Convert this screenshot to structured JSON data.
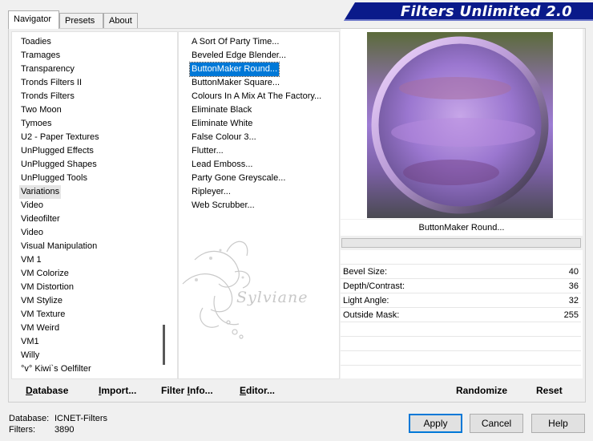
{
  "app": {
    "title": "Filters Unlimited 2.0"
  },
  "tabs": [
    {
      "label": "Navigator",
      "active": true
    },
    {
      "label": "Presets",
      "active": false
    },
    {
      "label": "About",
      "active": false
    }
  ],
  "categories": [
    "Toadies",
    "Tramages",
    "Transparency",
    "Tronds Filters II",
    "Tronds Filters",
    "Two Moon",
    "Tymoes",
    "U2 - Paper Textures",
    "UnPlugged Effects",
    "UnPlugged Shapes",
    "UnPlugged Tools",
    "Variations",
    "Video",
    "Videofilter",
    "Video",
    "Visual Manipulation",
    "VM 1",
    "VM Colorize",
    "VM Distortion",
    "VM Stylize",
    "VM Texture",
    "VM Weird",
    "VM1",
    "Willy",
    "°v° Kiwi`s Oelfilter"
  ],
  "selected_category_index": 11,
  "filters": [
    "A Sort Of Party Time...",
    "Beveled Edge Blender...",
    "ButtonMaker Round...",
    "ButtonMaker Square...",
    "Colours In A Mix At The Factory...",
    "Eliminate Black",
    "Eliminate White",
    "False Colour 3...",
    "Flutter...",
    "Lead Emboss...",
    "Party Gone Greyscale...",
    "Ripleyer...",
    "Web Scrubber..."
  ],
  "selected_filter_index": 2,
  "watermark": {
    "text": "Sylviane"
  },
  "preview": {
    "filter_name": "ButtonMaker Round..."
  },
  "params": [
    {
      "label": "Bevel Size:",
      "value": "40"
    },
    {
      "label": "Depth/Contrast:",
      "value": "36"
    },
    {
      "label": "Light Angle:",
      "value": "32"
    },
    {
      "label": "Outside Mask:",
      "value": "255"
    }
  ],
  "bottom_bar": {
    "database_prefix": "D",
    "database_rest": "atabase",
    "import_prefix": "I",
    "import_rest": "mport...",
    "filterinfo_prefix": "Filter ",
    "filterinfo_u": "I",
    "filterinfo_rest": "nfo...",
    "editor_prefix": "E",
    "editor_rest": "ditor...",
    "randomize": "Randomize",
    "reset": "Reset"
  },
  "status": {
    "database_label": "Database:",
    "database_value": "ICNET-Filters",
    "filters_label": "Filters:",
    "filters_value": "3890"
  },
  "buttons": {
    "apply": "Apply",
    "cancel": "Cancel",
    "help": "Help"
  },
  "colors": {
    "banner": "#0a1a8a",
    "selection": "#0078d7",
    "focus_border": "#0078d7"
  }
}
